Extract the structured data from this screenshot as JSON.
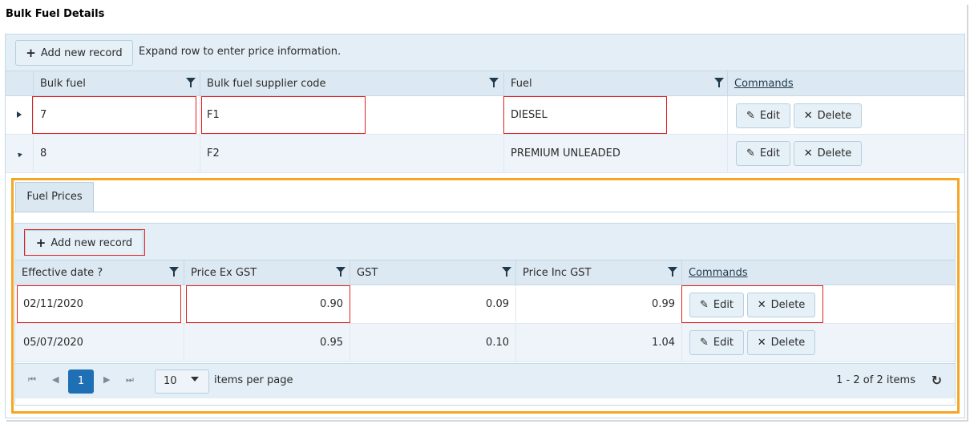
{
  "page": {
    "title": "Bulk Fuel Details"
  },
  "toolbar": {
    "add_label": "Add new record",
    "hint": "Expand row to enter price information."
  },
  "columns": {
    "bulk_fuel": "Bulk fuel",
    "supplier": "Bulk fuel supplier code",
    "fuel": "Fuel",
    "commands": "Commands"
  },
  "rows": [
    {
      "id": "7",
      "supplier": "F1",
      "fuel": "DIESEL",
      "expanded": false
    },
    {
      "id": "8",
      "supplier": "F2",
      "fuel": "PREMIUM UNLEADED",
      "expanded": true
    }
  ],
  "commands": {
    "edit": "Edit",
    "delete": "Delete"
  },
  "detail": {
    "tab": "Fuel Prices",
    "add_label": "Add new record",
    "columns": {
      "date": "Effective date ?",
      "ex": "Price Ex GST",
      "gst": "GST",
      "inc": "Price Inc GST",
      "commands": "Commands"
    },
    "rows": [
      {
        "date": "02/11/2020",
        "ex": "0.90",
        "gst": "0.09",
        "inc": "0.99"
      },
      {
        "date": "05/07/2020",
        "ex": "0.95",
        "gst": "0.10",
        "inc": "1.04"
      }
    ],
    "pager": {
      "page": "1",
      "page_size": "10",
      "per_page_label": "items per page",
      "info": "1 - 2 of 2 items"
    }
  },
  "colors": {
    "highlight": "#e02020",
    "detail_border": "#f5a623",
    "page_active": "#1f6fb4"
  }
}
